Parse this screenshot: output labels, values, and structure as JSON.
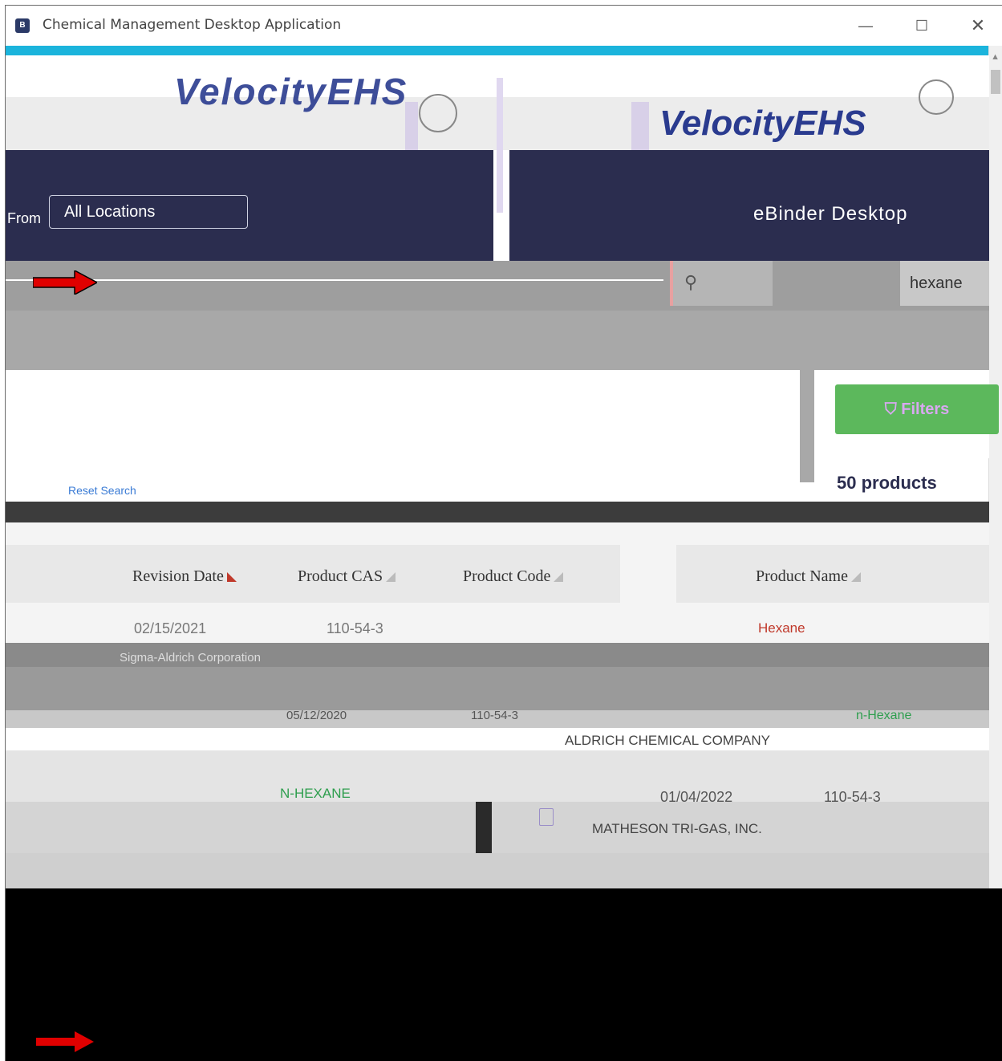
{
  "window": {
    "title": "Chemical Management Desktop Application",
    "minimize": "—",
    "maximize": "☐",
    "close": "✕"
  },
  "header": {
    "logo_left": "VelocityEHS",
    "logo_right": "VelocityEHS",
    "location_button": "All Locations",
    "location_prefix": "From",
    "binder_title": "eBinder Desktop"
  },
  "search": {
    "value": "hexane"
  },
  "filters": {
    "button_label": "Filters",
    "results_count": "50 products",
    "reset_label": "Reset Search"
  },
  "table": {
    "columns": [
      "Revision Date",
      "Product CAS",
      "Product Code",
      "Product Name"
    ],
    "rows": [
      {
        "manufacturer": "Sigma-Aldrich Corporation",
        "date": "02/15/2021",
        "cas": "110-54-3",
        "product": "Hexane"
      },
      {
        "manufacturer": "ALDRICH CHEMICAL COMPANY",
        "date": "05/12/2020",
        "cas": "110-54-3",
        "product": "n-Hexane"
      },
      {
        "manufacturer": "MATHESON TRI-GAS, INC.",
        "date": "01/04/2022",
        "cas": "110-54-3",
        "product": "N-HEXANE"
      }
    ]
  },
  "colors": {
    "accent": "#1bb4dc",
    "navy": "#2b2d4f",
    "filters_green": "#5cb85c",
    "arrow_red": "#e00000"
  }
}
